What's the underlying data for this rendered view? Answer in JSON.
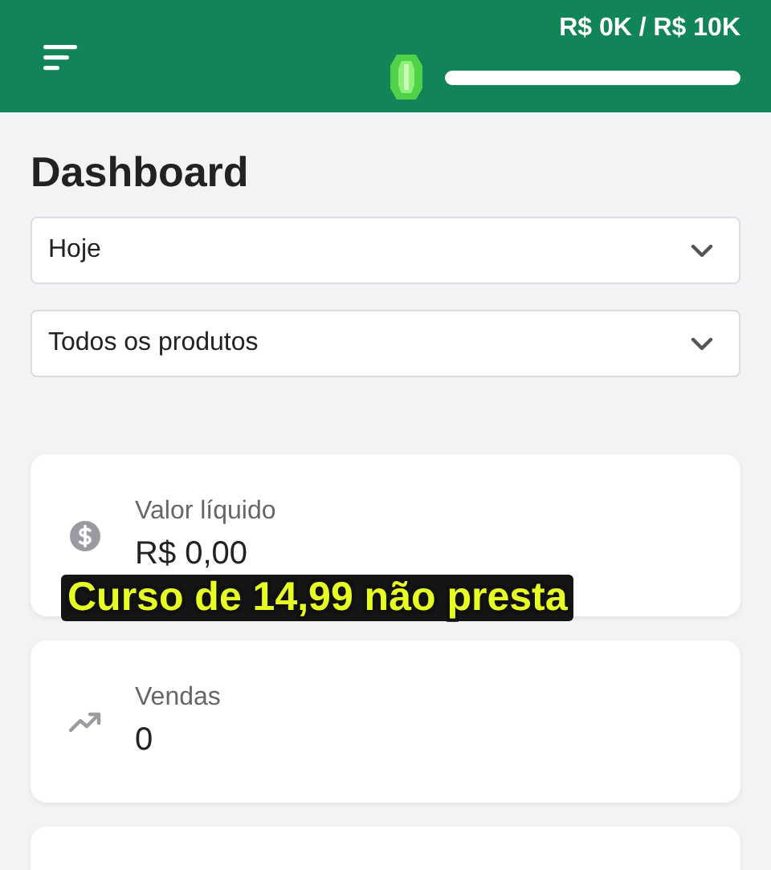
{
  "header": {
    "goal_text": "R$ 0K / R$ 10K",
    "goal_progress": {
      "level": 0
    }
  },
  "title": "Dashboard",
  "filters": [
    {
      "value": "Hoje"
    },
    {
      "value": "Todos os produtos"
    }
  ],
  "metrics": [
    {
      "kind": "money",
      "label": "Valor líquido",
      "value": "R$ 0,00"
    },
    {
      "kind": "trend",
      "label": "Vendas",
      "value": "0"
    },
    {
      "kind": "empty"
    }
  ],
  "caption": "Curso de 14,99 não presta"
}
